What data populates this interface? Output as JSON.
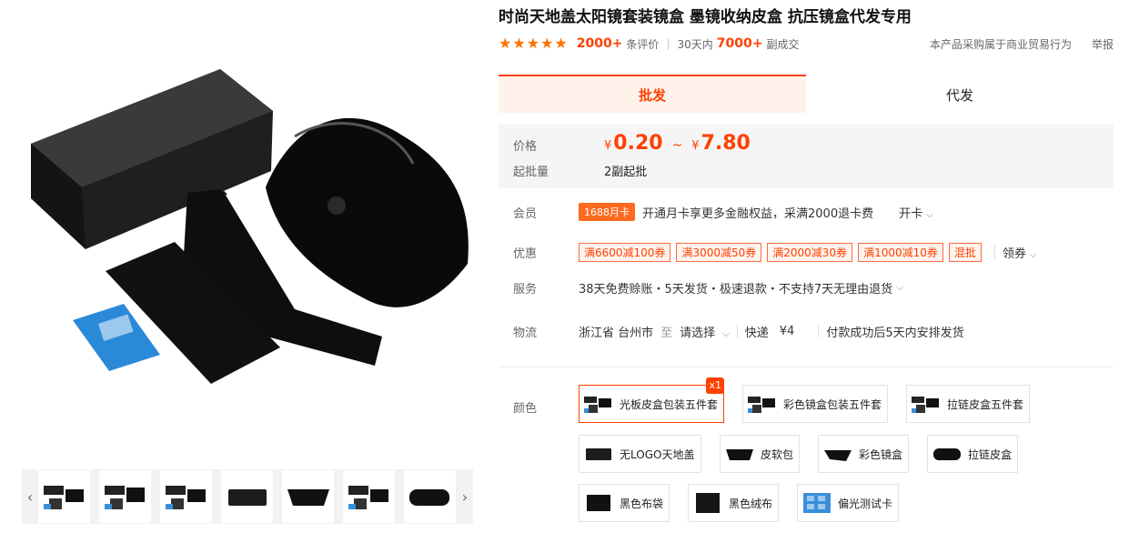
{
  "product": {
    "title": "时尚天地盖太阳镜套装镜盒 墨镜收纳皮盒 抗压镜盒代发专用"
  },
  "rating": {
    "reviews_count": "2000+",
    "reviews_label": "条评价",
    "period": "30天内",
    "sales_count": "7000+",
    "sales_label": "副成交",
    "trade_note": "本产品采购属于商业贸易行为",
    "report": "举报",
    "stars": 5
  },
  "tabs": [
    {
      "label": "批发",
      "active": true
    },
    {
      "label": "代发",
      "active": false
    }
  ],
  "price": {
    "label": "价格",
    "currency": "¥",
    "min": "0.20",
    "tilde": "~",
    "max": "7.80",
    "moq_label": "起批量",
    "moq_value": "2副起批"
  },
  "member": {
    "label": "会员",
    "badge": "1688月卡",
    "text": "开通月卡享更多金融权益，采满2000退卡费",
    "action": "开卡"
  },
  "discount": {
    "label": "优惠",
    "coupons": [
      "满6600减100券",
      "满3000减50券",
      "满2000减30券",
      "满1000减10券",
      "混批"
    ],
    "action": "领券"
  },
  "service": {
    "label": "服务",
    "text": "38天免费赊账・5天发货・极速退款・不支持7天无理由退货"
  },
  "logistics": {
    "label": "物流",
    "from": "浙江省 台州市",
    "to_word": "至",
    "select": "请选择",
    "express": "快递",
    "fee": "¥4",
    "ship_note": "付款成功后5天内安排发货"
  },
  "colors": {
    "label": "颜色",
    "options": [
      {
        "label": "光板皮盒包装五件套",
        "selected": true,
        "qty": "x1"
      },
      {
        "label": "彩色镜盒包装五件套",
        "selected": false
      },
      {
        "label": "拉链皮盒五件套",
        "selected": false
      },
      {
        "label": "无LOGO天地盖",
        "selected": false
      },
      {
        "label": "皮软包",
        "selected": false
      },
      {
        "label": "彩色镜盒",
        "selected": false
      },
      {
        "label": "拉链皮盒",
        "selected": false
      },
      {
        "label": "黑色布袋",
        "selected": false
      },
      {
        "label": "黑色绒布",
        "selected": false
      },
      {
        "label": "偏光测试卡",
        "selected": false
      }
    ]
  },
  "gallery": {
    "prev_icon": "‹",
    "next_icon": "›",
    "thumbnail_count": 7
  },
  "colors_hex": {
    "accent": "#ff4000",
    "star": "#ff7300",
    "tab_bg": "#fff2ea"
  }
}
